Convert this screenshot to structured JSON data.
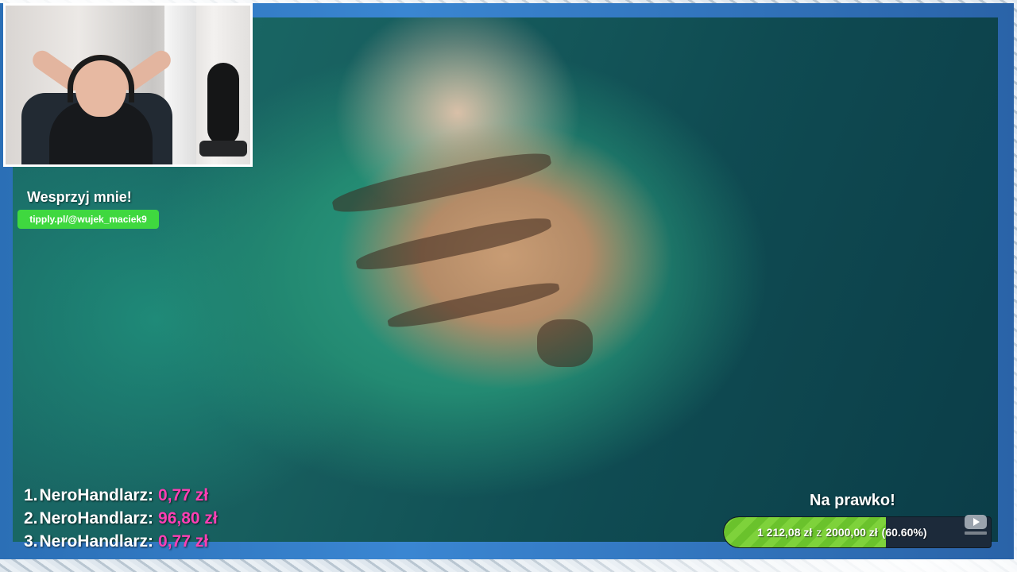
{
  "support": {
    "title": "Wesprzyj mnie!",
    "link": "tipply.pl/@wujek_maciek9"
  },
  "leaderboard": [
    {
      "rank": "1.",
      "name": "NeroHandlarz:",
      "amount": "0,77 zł"
    },
    {
      "rank": "2.",
      "name": "NeroHandlarz:",
      "amount": "96,80 zł"
    },
    {
      "rank": "3.",
      "name": "NeroHandlarz:",
      "amount": "0,77 zł"
    }
  ],
  "goal": {
    "title": "Na prawko!",
    "current": "1 212,08 zł",
    "separator": "z",
    "target": "2000,00 zł",
    "percent_text": "(60.60%)",
    "progress": 0.606
  },
  "icons": {
    "subscribe": "youtube-subscribe-icon"
  },
  "colors": {
    "support_green": "#3fd83f",
    "amount_pink": "#ff3fb4",
    "goal_green": "#7ed23b",
    "border_blue": "#3a86d2"
  }
}
